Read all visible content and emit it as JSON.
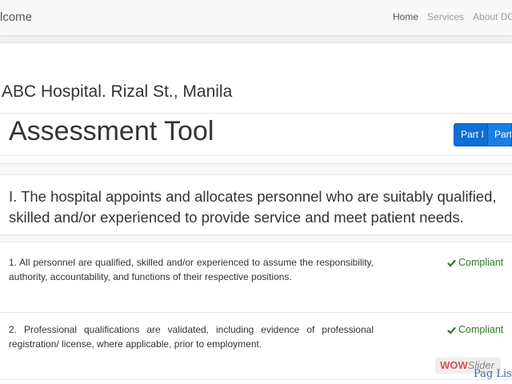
{
  "navbar": {
    "brand": "lcome",
    "links": [
      {
        "label": "Home",
        "active": true
      },
      {
        "label": "Services",
        "active": false
      },
      {
        "label": "About DOH",
        "active": false
      }
    ]
  },
  "header": {
    "hospital": "ABC Hospital. Rizal St., Manila",
    "title": "Assessment Tool",
    "parts": [
      "Part I",
      "Part"
    ]
  },
  "standard": {
    "line1": "I. The hospital appoints and allocates personnel who are suitably qualified,",
    "line2": "skilled and/or experienced to provide service and meet patient needs."
  },
  "criteria": [
    {
      "text": "1. All personnel are qualified, skilled and/or experienced to assume the responsibility, authority, accountability, and functions of their respective positions.",
      "status": "Compliant"
    },
    {
      "text": "2. Professional qualifications are validated, including evidence of professional registration/ license, where applicable, prior to employment.",
      "status": "Compliant"
    }
  ],
  "watermark": {
    "logo_wow": "WOW",
    "logo_slider": "Slider",
    "link": "Pag List"
  },
  "colors": {
    "primary": "#0f6fd6",
    "success": "#2a7a2a"
  },
  "icons": {
    "compliant": "check-icon"
  }
}
